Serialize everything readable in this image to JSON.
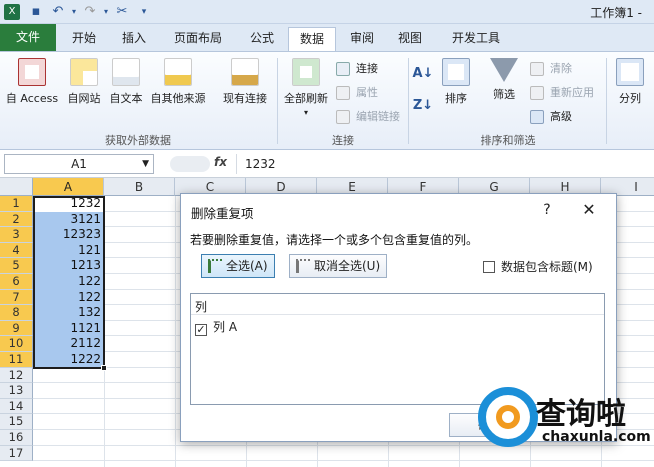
{
  "window": {
    "title": "工作簿1 -"
  },
  "tabs": [
    "文件",
    "开始",
    "插入",
    "页面布局",
    "公式",
    "数据",
    "审阅",
    "视图",
    "开发工具"
  ],
  "ribbon": {
    "external_data": {
      "buttons": [
        "自 Access",
        "自网站",
        "自文本",
        "自其他来源",
        "现有连接"
      ],
      "label": "获取外部数据"
    },
    "connections": {
      "refresh": "全部刷新",
      "small": [
        "连接",
        "属性",
        "编辑链接"
      ],
      "label": "连接"
    },
    "sort_filter": {
      "sort": "排序",
      "filter": "筛选",
      "small": [
        "清除",
        "重新应用",
        "高级"
      ],
      "label": "排序和筛选"
    },
    "split": "分列"
  },
  "formula_bar": {
    "name_box": "A1",
    "fx": "fx",
    "value": "1232"
  },
  "grid": {
    "columns": [
      "A",
      "B",
      "C",
      "D",
      "E",
      "F",
      "G",
      "H",
      "I"
    ],
    "rows": [
      "1",
      "2",
      "3",
      "4",
      "5",
      "6",
      "7",
      "8",
      "9",
      "10",
      "11",
      "12",
      "13",
      "14",
      "15",
      "16",
      "17"
    ],
    "values": [
      "1232",
      "3121",
      "12323",
      "121",
      "1213",
      "122",
      "122",
      "132",
      "1121",
      "2112",
      "1222"
    ]
  },
  "dialog": {
    "title": "删除重复项",
    "help": "?",
    "close": "✕",
    "message": "若要删除重复值，请选择一个或多个包含重复值的列。",
    "select_all": "全选(A)",
    "unselect_all": "取消全选(U)",
    "has_headers": "数据包含标题(M)",
    "list_header": "列",
    "column_item": "列 A",
    "ok_partial": "确"
  },
  "watermark": {
    "text": "查询啦",
    "url": "chaxunla.com"
  },
  "colors": {
    "file_tab": "#2a7d3c",
    "selection": "#a8c8ee",
    "header_highlight": "#f8c94f",
    "watermark_blue": "#1b8fd8",
    "watermark_orange": "#f19a1f"
  }
}
